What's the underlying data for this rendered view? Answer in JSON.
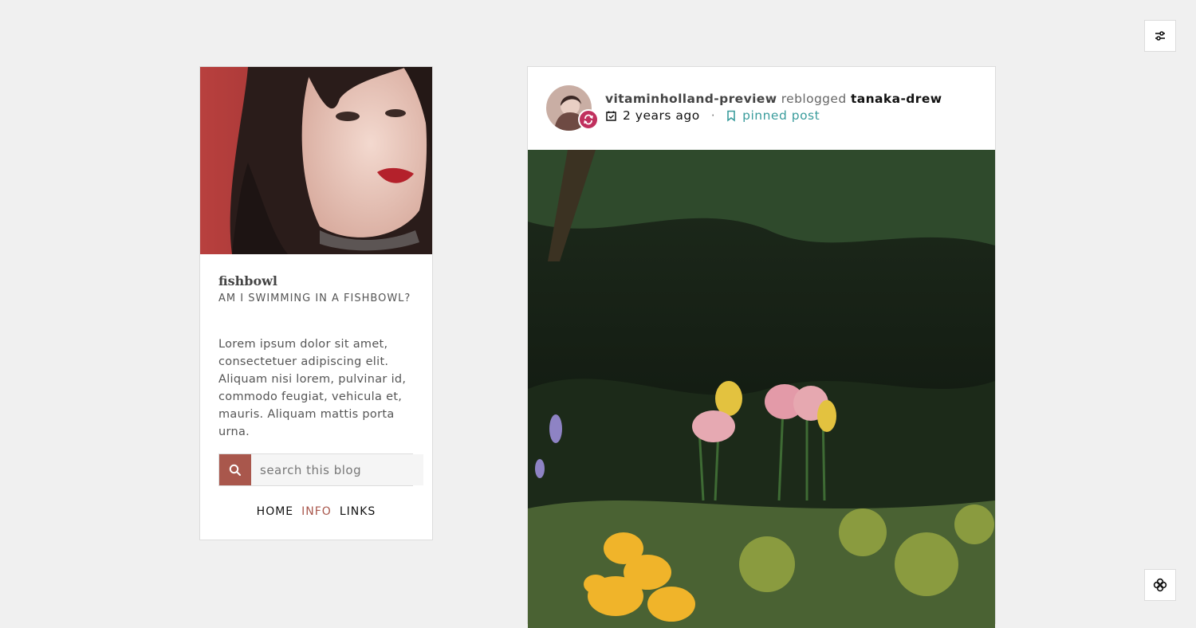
{
  "sidebar": {
    "title": "fishbowl",
    "subtitle": "AM I SWIMMING IN A FISHBOWL?",
    "description": "Lorem ipsum dolor sit amet, consectetuer adipiscing elit. Aliquam nisi lorem, pulvinar id, commodo feugiat, vehicula et, mauris. Aliquam mattis porta urna.",
    "search": {
      "placeholder": "search this blog",
      "icon": "search-icon"
    },
    "nav": [
      {
        "label": "HOME",
        "active": false
      },
      {
        "label": "INFO",
        "active": true
      },
      {
        "label": "LINKS",
        "active": false
      }
    ]
  },
  "post": {
    "poster": "vitaminholland-preview",
    "verb": "reblogged",
    "origin": "tanaka-drew",
    "time": "2 years ago",
    "separator": "·",
    "pinned_label": "pinned post"
  },
  "controls": {
    "settings_icon": "sliders-icon",
    "clover_icon": "clover-icon"
  },
  "colors": {
    "accent": "#a9574c",
    "reblog_badge": "#c0305e",
    "pinned": "#3a9c9c",
    "background": "#f0f0f0"
  }
}
